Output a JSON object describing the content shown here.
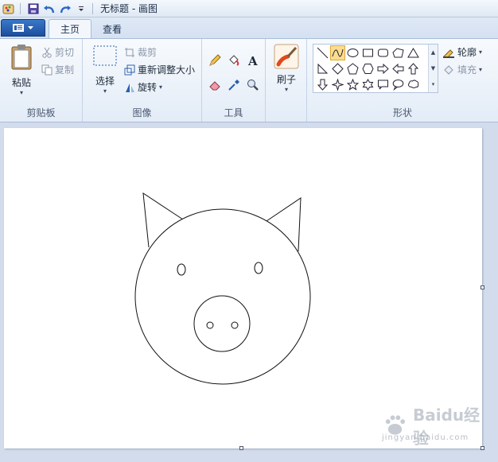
{
  "window": {
    "title": "无标题 - 画图"
  },
  "quick_access": {
    "items": [
      "paint-app-icon",
      "save-icon",
      "undo-icon",
      "redo-icon",
      "customize-dropdown-icon"
    ]
  },
  "tabs": [
    {
      "label": "主页",
      "active": true
    },
    {
      "label": "查看",
      "active": false
    }
  ],
  "ribbon": {
    "clipboard": {
      "group_label": "剪贴板",
      "paste": "粘贴",
      "cut": "剪切",
      "copy": "复制"
    },
    "image": {
      "group_label": "图像",
      "select": "选择",
      "crop": "裁剪",
      "resize": "重新调整大小",
      "rotate": "旋转"
    },
    "tools": {
      "group_label": "工具"
    },
    "brushes": {
      "label": "刷子"
    },
    "shapes": {
      "group_label": "形状",
      "outline": "轮廓",
      "fill": "填充",
      "selected_shape": "curve"
    }
  },
  "watermark": {
    "text": "Baidu经验",
    "subtext": "jingyan.baidu.com"
  },
  "colors": {
    "accent": "#2b5fae",
    "selection": "#fbdd8f"
  }
}
